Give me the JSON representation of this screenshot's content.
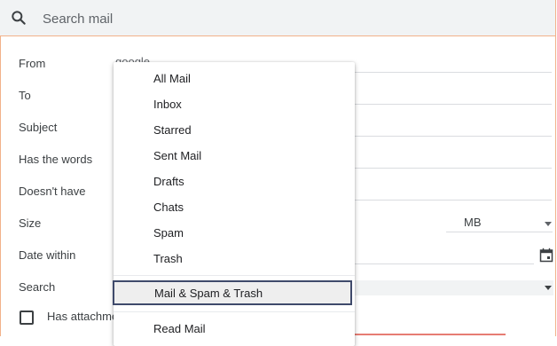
{
  "search": {
    "placeholder": "Search mail"
  },
  "form": {
    "from_label": "From",
    "from_value_partial": "google",
    "to_label": "To",
    "subject_label": "Subject",
    "has_words_label": "Has the words",
    "doesnt_have_label": "Doesn't have",
    "size_label": "Size",
    "size_unit": "MB",
    "date_within_label": "Date within",
    "search_label": "Search",
    "has_attachment_label": "Has attachment"
  },
  "menu": {
    "items": [
      "All Mail",
      "Inbox",
      "Starred",
      "Sent Mail",
      "Drafts",
      "Chats",
      "Spam",
      "Trash"
    ],
    "selected": "Mail & Spam & Trash",
    "after": "Read Mail"
  },
  "colors": {
    "accent_border": "#f2b28a",
    "selected_outline": "#3f4a6b"
  }
}
